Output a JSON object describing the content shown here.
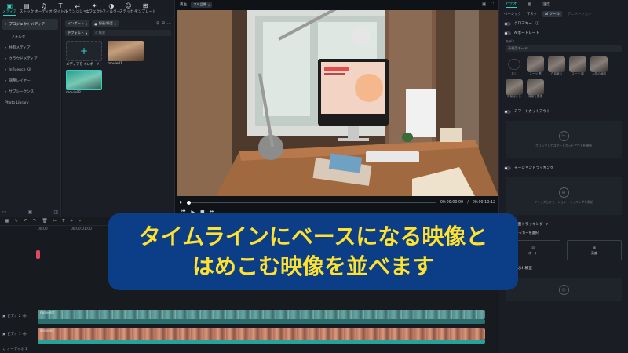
{
  "nav_tabs": [
    {
      "label": "メディア",
      "icon": "media-icon"
    },
    {
      "label": "ストック",
      "icon": "stock-icon"
    },
    {
      "label": "オーディオ",
      "icon": "audio-icon"
    },
    {
      "label": "タイトル",
      "icon": "title-icon"
    },
    {
      "label": "トランジション",
      "icon": "transition-icon"
    },
    {
      "label": "エフェクト",
      "icon": "effect-icon"
    },
    {
      "label": "フィルター",
      "icon": "filter-icon"
    },
    {
      "label": "ステッカー",
      "icon": "sticker-icon"
    },
    {
      "label": "テンプレート",
      "icon": "template-icon"
    }
  ],
  "left_panel": {
    "items": [
      {
        "label": "プロジェクトメディア"
      },
      {
        "label": "フォルダ"
      },
      {
        "label": "共有メディア"
      },
      {
        "label": "クラウドメディア"
      },
      {
        "label": "Influence Kit"
      },
      {
        "label": "調整レイヤー"
      },
      {
        "label": "サブシーケンス"
      },
      {
        "label": "Photo Library"
      }
    ]
  },
  "media": {
    "import_label": "インポート",
    "record_label": "録画/録音",
    "default_label": "デフォルト",
    "search_placeholder": "検索",
    "items": [
      {
        "caption": "メディアをインポート"
      },
      {
        "caption": "movie01"
      },
      {
        "caption": "movie02"
      }
    ]
  },
  "preview": {
    "player_label": "再生",
    "quality_label": "フル品質",
    "current_time": "00:00:00:00",
    "total_time": "00:00:10:12"
  },
  "right_panel": {
    "tabs": [
      "ビデオ",
      "色",
      "速度"
    ],
    "subtabs": [
      "ベーシック",
      "マスク",
      "AI ツール",
      "アニメーション"
    ],
    "chroma_label": "クロマキー",
    "ai_portrait_label": "AIポートレート",
    "model_label": "モデル",
    "model_value": "高精度モード",
    "face_labels": [
      "なし",
      "スーツ 黒",
      "白背景 1",
      "スーツ 緑",
      "人物の輪郭",
      "背景ぼかし",
      "背景を置換"
    ],
    "smart_cutout_label": "スマートカットアウト",
    "smart_cutout_hint": "クリックしてスマートカットアウトを開始",
    "motion_tracking_label": "モーショントラッキング",
    "motion_tracking_hint": "クリックしてモーショントラッキングを開始",
    "planar_tracking_label": "平面トラッキング",
    "planar_tracker_select": "平面トラッカーを選択",
    "auto_label": "オート",
    "advanced_label": "高度",
    "stabilize_label": "手ぶれ補正"
  },
  "timeline": {
    "ruler_ticks": [
      "00:00",
      "00:00:01:00"
    ],
    "tracks": [
      {
        "label": "ビデオ 2"
      },
      {
        "label": "ビデオ 1"
      },
      {
        "label": "オーディオ 1"
      }
    ],
    "clip_names": [
      "movie02",
      "movie01"
    ]
  },
  "caption": {
    "line1": "タイムラインにベースになる映像と",
    "line2": "はめこむ映像を並べます"
  },
  "colors": {
    "accent": "#2fd3c6",
    "caption_bg": "#0b3e86",
    "caption_text": "#ffe12e",
    "playhead": "#e04a5e"
  }
}
